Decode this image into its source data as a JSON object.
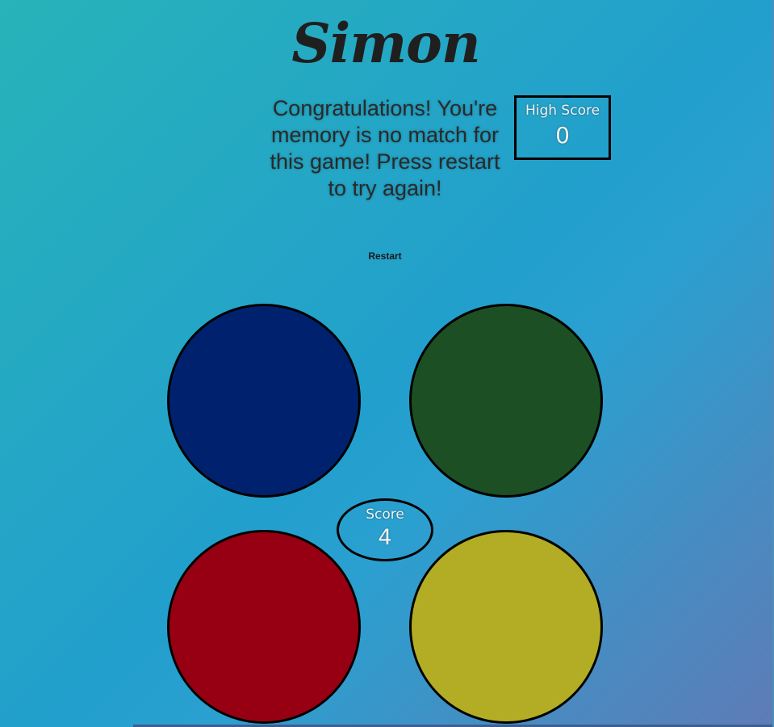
{
  "game": {
    "title": "Simon",
    "message": "Congratulations! You're memory is no match for this game! Press restart to try again!",
    "restart_label": "Restart"
  },
  "high_score": {
    "label": "High Score",
    "value": "0"
  },
  "score": {
    "label": "Score",
    "value": "4"
  },
  "pads": [
    {
      "color_name": "blue",
      "color": "#00226e"
    },
    {
      "color_name": "green",
      "color": "#1d4f24"
    },
    {
      "color_name": "red",
      "color": "#970013"
    },
    {
      "color_name": "yellow",
      "color": "#b2ad24"
    }
  ],
  "colors": {
    "background_start": "#27b3b9",
    "background_end": "#5f7bb6",
    "text_dark": "#1f1f1f",
    "text_light": "#f2f2f2"
  }
}
